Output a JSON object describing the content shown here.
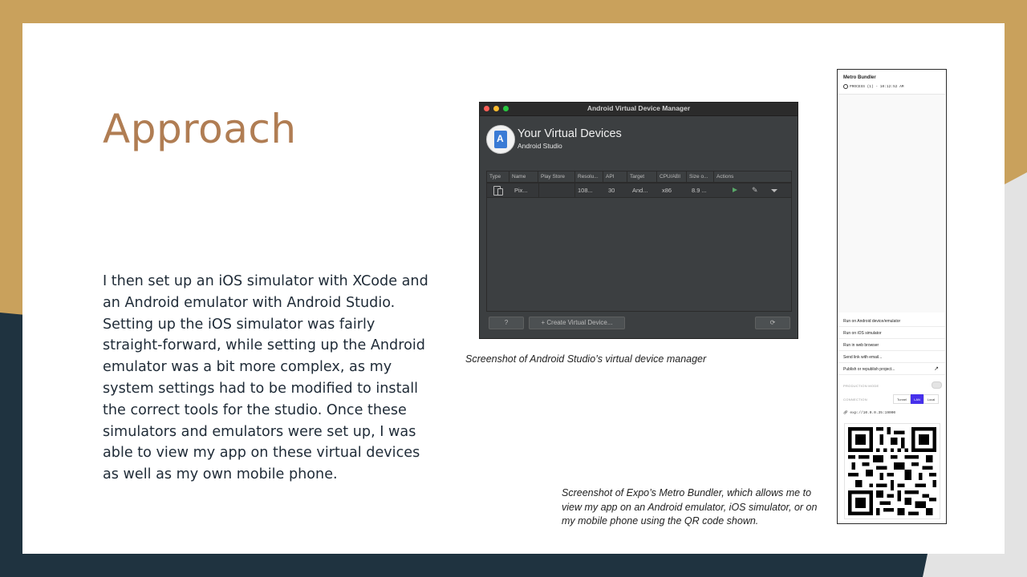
{
  "slide": {
    "title": "Approach",
    "body": "I then set up an iOS simulator with XCode and an Android emulator with Android Studio. Setting up the iOS simulator was fairly straight-forward, while setting up the Android emulator was a bit more complex, as my system settings had to be modified to install the correct tools for the studio. Once these simulators and emulators were set up, I was able to view my app on these virtual devices as well as my own mobile phone.",
    "caption_avd": "Screenshot of Android Studio’s virtual device manager",
    "caption_metro": "Screenshot of Expo’s Metro Bundler, which allows me to view my app on an Android emulator, iOS simulator, or on my mobile phone using the QR code shown."
  },
  "colors": {
    "accent_gold": "#c9a15c",
    "dark_navy": "#1f3340",
    "title_color": "#b07d53",
    "light_gray": "#e3e3e3",
    "metro_active": "#4630eb"
  },
  "avd": {
    "window_title": "Android Virtual Device Manager",
    "heading": "Your Virtual Devices",
    "subheading": "Android Studio",
    "columns": [
      "Type",
      "Name",
      "Play Store",
      "Resolu...",
      "API",
      "Target",
      "CPU/ABI",
      "Size o...",
      "Actions"
    ],
    "row": {
      "name": "Pix...",
      "play_store": "",
      "resolution": "108...",
      "api": "30",
      "target": "And...",
      "cpu": "x86",
      "size": "8.9 ..."
    },
    "help_button": "?",
    "create_button": "+ Create Virtual Device...",
    "refresh_icon": "refresh-icon",
    "play_icon": "play-icon",
    "edit_icon": "pencil-icon",
    "more_icon": "chevron-down-icon"
  },
  "metro": {
    "title": "Metro Bundler",
    "process": "PROCESS (1) - 10:12:52 AM",
    "actions": [
      "Run on Android device/emulator",
      "Run on iOS simulator",
      "Run in web browser",
      "Send link with email...",
      "Publish or republish project..."
    ],
    "production_mode_label": "PRODUCTION MODE",
    "connection_label": "CONNECTION",
    "connection_options": [
      "Tunnel",
      "LAN",
      "Local"
    ],
    "connection_selected": "LAN",
    "url": "exp://10.0.0.35:19000"
  }
}
